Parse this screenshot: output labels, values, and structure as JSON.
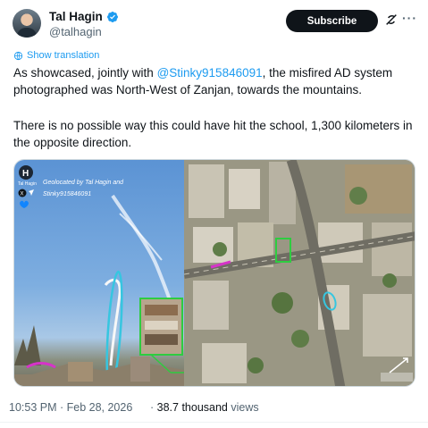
{
  "author": {
    "name": "Tal Hagin",
    "handle": "@talhagin"
  },
  "header": {
    "subscribe_label": "Subscribe"
  },
  "translate_label": "Show translation",
  "tweet": {
    "line1_before": "As showcased, jointly with ",
    "mention": "@Stinky915846091",
    "line1_after": ", the misfired AD system photographed was North-West of Zanjan, towards the mountains.",
    "paragraph2": "There is no possible way this could have hit the school, 1,300 kilometers in the opposite direction."
  },
  "media": {
    "overlay_line1": "Geolocated by Tal Hagin and",
    "overlay_line2": "Stinky915846091",
    "logo_label": "Tal Hagin",
    "logo_letter": "H"
  },
  "meta": {
    "timestamp": "10:53 PM · Feb 28, 2026",
    "views_count": "38.7 thousand",
    "views_label": "views"
  },
  "colors": {
    "accent": "#1d9bf0",
    "overlay_green": "#2ecc40",
    "overlay_cyan": "#36c6e0",
    "overlay_magenta": "#d633c8"
  }
}
